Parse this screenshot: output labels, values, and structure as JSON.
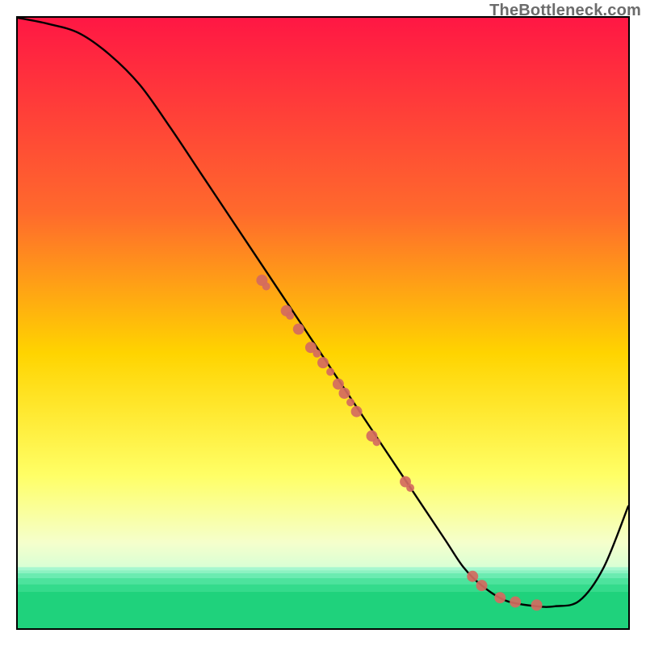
{
  "watermark": "TheBottleneck.com",
  "chart_data": {
    "type": "line",
    "title": "",
    "xlabel": "",
    "ylabel": "",
    "xlim": [
      0,
      100
    ],
    "ylim": [
      0,
      100
    ],
    "background_gradient": {
      "stops": [
        {
          "offset": 0.0,
          "color": "#ff1744"
        },
        {
          "offset": 0.32,
          "color": "#ff6a2c"
        },
        {
          "offset": 0.55,
          "color": "#ffd400"
        },
        {
          "offset": 0.75,
          "color": "#ffff66"
        },
        {
          "offset": 0.86,
          "color": "#f5ffcc"
        },
        {
          "offset": 0.92,
          "color": "#ccffd9"
        },
        {
          "offset": 0.97,
          "color": "#4be38f"
        },
        {
          "offset": 1.0,
          "color": "#18c96b"
        }
      ],
      "bands": [
        {
          "y0": 0.9,
          "y1": 0.905,
          "color": "#a6f7cf"
        },
        {
          "y0": 0.905,
          "y1": 0.91,
          "color": "#8cf2c2"
        },
        {
          "y0": 0.91,
          "y1": 0.918,
          "color": "#6bebb1"
        },
        {
          "y0": 0.918,
          "y1": 0.928,
          "color": "#4de39d"
        },
        {
          "y0": 0.928,
          "y1": 0.94,
          "color": "#34db8c"
        },
        {
          "y0": 0.94,
          "y1": 1.0,
          "color": "#1fd27c"
        }
      ]
    },
    "curve": {
      "x": [
        0,
        5,
        10,
        15,
        20,
        25,
        30,
        35,
        40,
        45,
        50,
        55,
        60,
        65,
        70,
        73,
        76,
        80,
        85,
        88,
        92,
        96,
        100
      ],
      "y": [
        100,
        99,
        97.5,
        94,
        89,
        82,
        74.5,
        67,
        59.5,
        52,
        44.5,
        37,
        29.5,
        22,
        14.5,
        10,
        7,
        4.5,
        3.6,
        3.6,
        4.5,
        10,
        20
      ]
    },
    "scatter": {
      "color": "#d46a5f",
      "radius_major": 7,
      "radius_minor": 5,
      "points": [
        {
          "x": 40.0,
          "y": 57.0,
          "r": 7
        },
        {
          "x": 40.7,
          "y": 56.0,
          "r": 5
        },
        {
          "x": 44.0,
          "y": 52.0,
          "r": 7
        },
        {
          "x": 44.6,
          "y": 51.2,
          "r": 5
        },
        {
          "x": 46.0,
          "y": 49.0,
          "r": 7
        },
        {
          "x": 48.0,
          "y": 46.0,
          "r": 7
        },
        {
          "x": 49.0,
          "y": 45.0,
          "r": 5
        },
        {
          "x": 50.0,
          "y": 43.5,
          "r": 7
        },
        {
          "x": 51.2,
          "y": 42.0,
          "r": 5
        },
        {
          "x": 52.5,
          "y": 40.0,
          "r": 7
        },
        {
          "x": 53.5,
          "y": 38.5,
          "r": 7
        },
        {
          "x": 54.5,
          "y": 37.0,
          "r": 5
        },
        {
          "x": 55.5,
          "y": 35.5,
          "r": 7
        },
        {
          "x": 58.0,
          "y": 31.5,
          "r": 7
        },
        {
          "x": 58.8,
          "y": 30.5,
          "r": 5
        },
        {
          "x": 63.5,
          "y": 24.0,
          "r": 7
        },
        {
          "x": 64.3,
          "y": 23.0,
          "r": 5
        },
        {
          "x": 74.5,
          "y": 8.5,
          "r": 7
        },
        {
          "x": 76.0,
          "y": 7.0,
          "r": 7
        },
        {
          "x": 79.0,
          "y": 5.0,
          "r": 7
        },
        {
          "x": 81.5,
          "y": 4.3,
          "r": 7
        },
        {
          "x": 85.0,
          "y": 3.8,
          "r": 7
        }
      ]
    }
  }
}
